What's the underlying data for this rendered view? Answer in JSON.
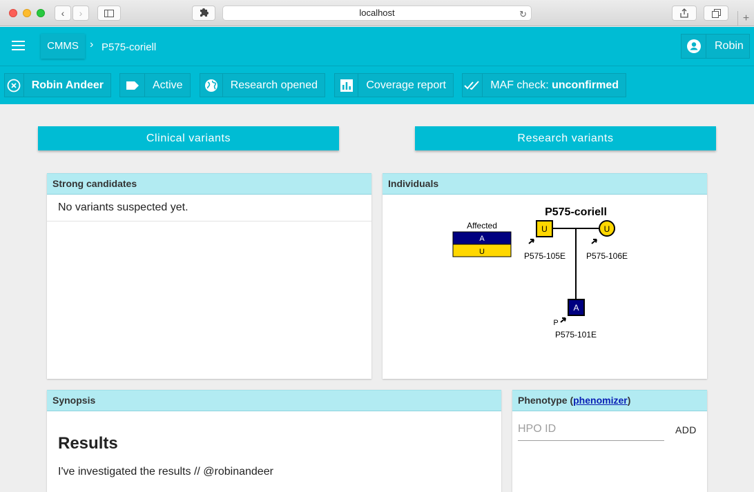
{
  "browser": {
    "url": "localhost",
    "plus": "+"
  },
  "appbar": {
    "brand": "CMMS",
    "breadcrumb": "P575-coriell",
    "user": "Robin"
  },
  "status": {
    "assignee": "Robin Andeer",
    "state": "Active",
    "research": "Research opened",
    "coverage": "Coverage report",
    "maf_prefix": "MAF check:",
    "maf_value": "unconfirmed"
  },
  "buttons": {
    "clinical": "Clinical variants",
    "research": "Research variants"
  },
  "candidates": {
    "title": "Strong candidates",
    "empty": "No variants suspected yet."
  },
  "individuals": {
    "title": "Individuals",
    "pedigree": {
      "family": "P575-coriell",
      "legend_title": "Affected",
      "legend_affected": "A",
      "legend_unaffected": "U",
      "father": {
        "id": "P575-105E",
        "status": "U"
      },
      "mother": {
        "id": "P575-106E",
        "status": "U"
      },
      "child": {
        "id": "P575-101E",
        "status": "A",
        "proband": "P"
      },
      "colors": {
        "affected": "#000080",
        "unaffected": "#ffd700"
      }
    }
  },
  "synopsis": {
    "title": "Synopsis",
    "heading": "Results",
    "text": "I've investigated the results // @robinandeer"
  },
  "phenotype": {
    "title": "Phenotype (",
    "link": "phenomizer",
    "title_end": ")",
    "placeholder": "HPO ID",
    "add": "ADD"
  }
}
